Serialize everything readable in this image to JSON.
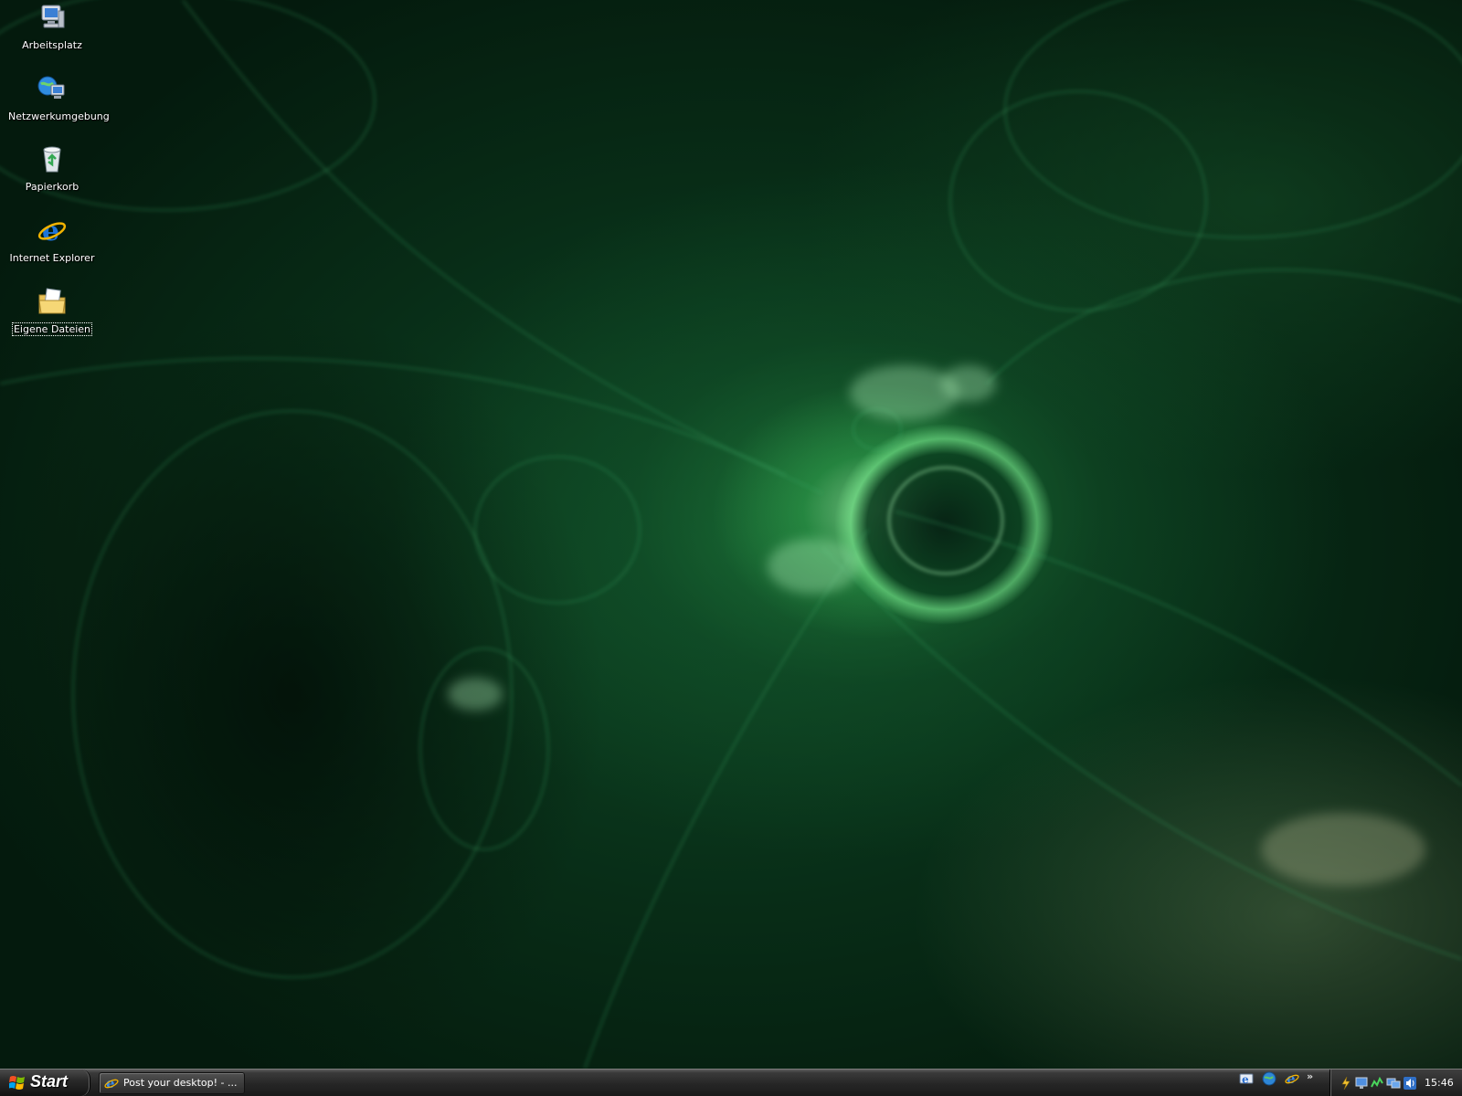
{
  "desktop": {
    "icons": [
      {
        "label": "Arbeitsplatz",
        "icon": "my-computer-icon"
      },
      {
        "label": "Netzwerkumgebung",
        "icon": "network-places-icon"
      },
      {
        "label": "Papierkorb",
        "icon": "recycle-bin-icon"
      },
      {
        "label": "Internet Explorer",
        "icon": "internet-explorer-icon"
      },
      {
        "label": "Eigene Dateien",
        "icon": "my-documents-folder-icon"
      }
    ],
    "wallpaper": "green-fractal-wallpaper"
  },
  "taskbar": {
    "start_label": "Start",
    "tasks": [
      {
        "label": "Post your desktop! - ...",
        "icon": "internet-explorer-icon"
      }
    ],
    "quick_launch": [
      {
        "icon": "outlook-express-icon"
      },
      {
        "icon": "globe-icon"
      },
      {
        "icon": "internet-explorer-icon"
      }
    ],
    "quick_launch_more": "»",
    "tray_icons": [
      "power-icon",
      "display-icon",
      "network-activity-icon",
      "network-connection-icon",
      "volume-icon"
    ],
    "clock": "15:46"
  },
  "colors": {
    "wallpaper_base": "#082d17",
    "wallpaper_glow": "#7fe08f",
    "taskbar": "#262626"
  }
}
